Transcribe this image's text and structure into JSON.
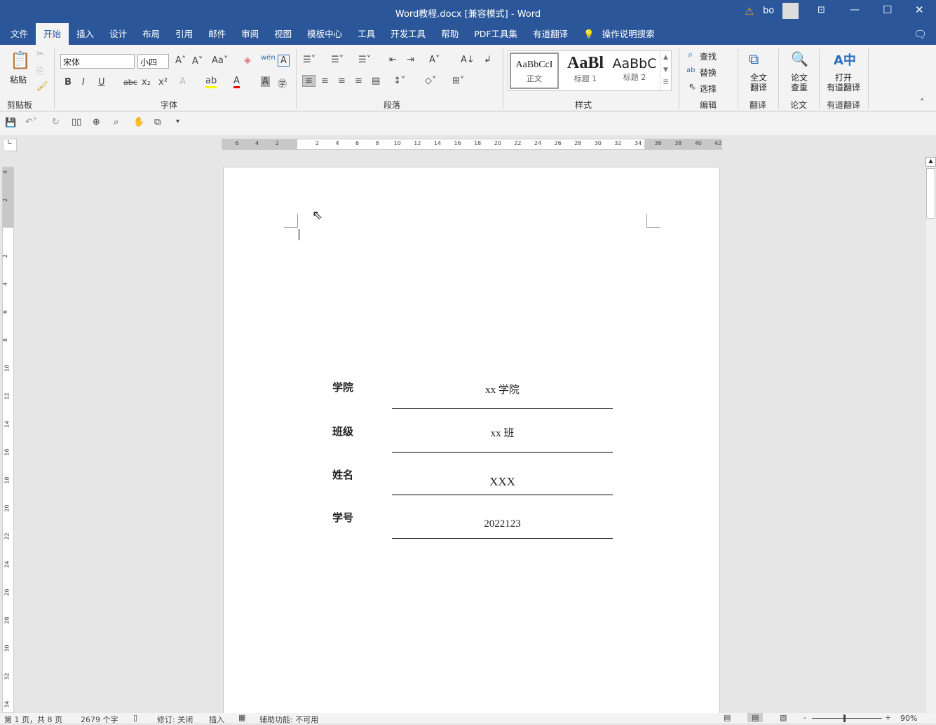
{
  "titlebar": {
    "title": "Word教程.docx [兼容模式]  -  Word",
    "user": "bo"
  },
  "tabs": [
    "文件",
    "开始",
    "插入",
    "设计",
    "布局",
    "引用",
    "邮件",
    "审阅",
    "视图",
    "模板中心",
    "工具",
    "开发工具",
    "帮助",
    "PDF工具集",
    "有道翻译"
  ],
  "tell_me": "操作说明搜索",
  "ribbon": {
    "clipboard": {
      "paste": "粘贴",
      "label": "剪贴板"
    },
    "font": {
      "name": "宋体",
      "size": "小四",
      "label": "字体"
    },
    "paragraph": {
      "label": "段落"
    },
    "styles": {
      "items": [
        {
          "preview": "AaBbCcI",
          "name": "正文"
        },
        {
          "preview": "AaBl",
          "name": "标题 1"
        },
        {
          "preview": "AaBbC",
          "name": "标题 2"
        }
      ],
      "label": "样式"
    },
    "editing": {
      "find": "查找",
      "replace": "替换",
      "select": "选择",
      "label": "编辑"
    },
    "translate": {
      "btn1": "全文",
      "btn2": "翻译",
      "label": "翻译"
    },
    "thesis": {
      "btn1": "论文",
      "btn2": "查重",
      "label": "论文"
    },
    "youdao": {
      "btn1": "打开",
      "btn2": "有道翻译",
      "label": "有道翻译"
    }
  },
  "ruler": {
    "h": [
      "6",
      "4",
      "2",
      "",
      "2",
      "4",
      "6",
      "8",
      "10",
      "12",
      "14",
      "16",
      "18",
      "20",
      "22",
      "24",
      "26",
      "28",
      "30",
      "32",
      "34",
      "36",
      "38",
      "40",
      "42"
    ],
    "v": [
      "4",
      "2",
      "",
      "2",
      "4",
      "6",
      "8",
      "10",
      "12",
      "14",
      "16",
      "18",
      "20",
      "22",
      "24",
      "26",
      "28",
      "30",
      "32",
      "34"
    ]
  },
  "form": [
    {
      "label": "学院",
      "value": "xx 学院"
    },
    {
      "label": "班级",
      "value": "xx 班"
    },
    {
      "label": "姓名",
      "value": "XXX"
    },
    {
      "label": "学号",
      "value": "2022123"
    }
  ],
  "status": {
    "page": "第 1 页，共 8 页",
    "words": "2679 个字",
    "track": "修订: 关闭",
    "insert": "插入",
    "accessibility": "辅助功能: 不可用",
    "zoom": "90%",
    "zoom_percent": 90
  },
  "colors": {
    "brand": "#2b579a",
    "highlight": "#ffff00",
    "font_color": "#ff0000"
  }
}
